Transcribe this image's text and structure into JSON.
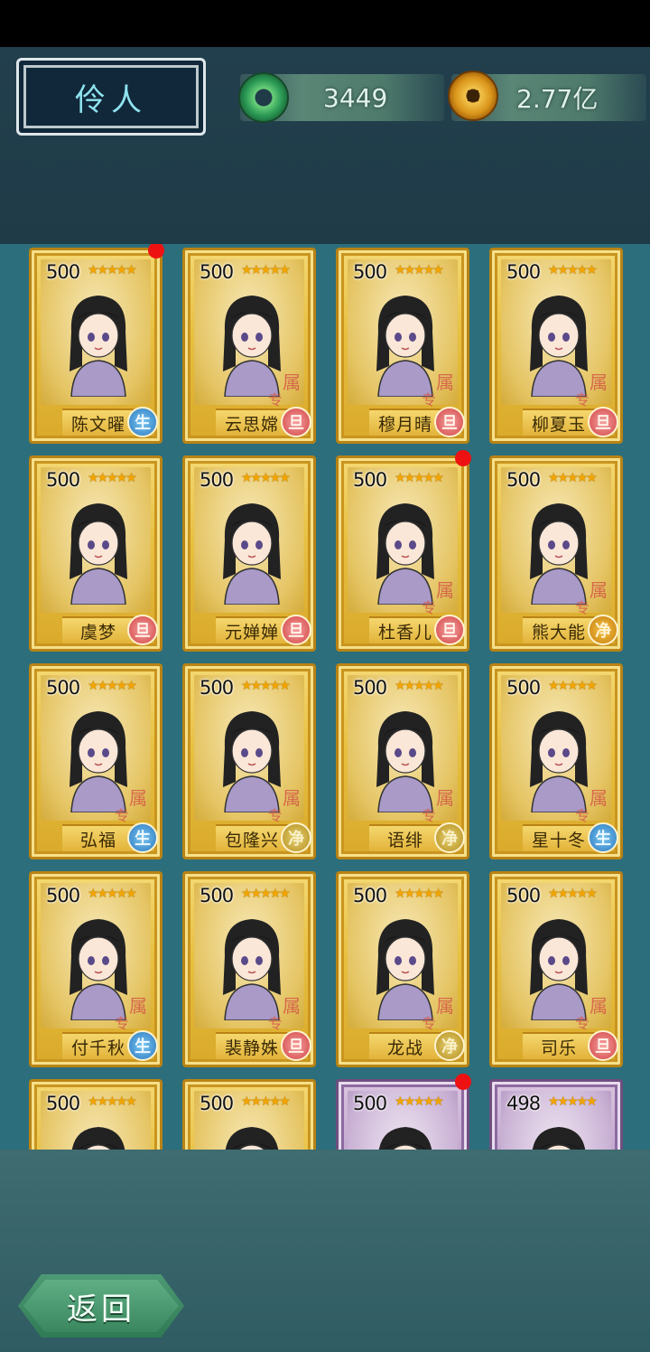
{
  "header": {
    "title": "伶人",
    "currency_jade": "3449",
    "currency_coin": "2.77亿"
  },
  "cards": [
    {
      "level": "500",
      "name": "陈文曜",
      "badge": "生",
      "badge_color": "blue",
      "dot": true,
      "frame": "gold",
      "tag": false
    },
    {
      "level": "500",
      "name": "云思嫦",
      "badge": "旦",
      "badge_color": "red",
      "dot": false,
      "frame": "gold",
      "tag": true
    },
    {
      "level": "500",
      "name": "穆月晴",
      "badge": "旦",
      "badge_color": "red",
      "dot": false,
      "frame": "gold",
      "tag": true
    },
    {
      "level": "500",
      "name": "柳夏玉",
      "badge": "旦",
      "badge_color": "red",
      "dot": false,
      "frame": "gold",
      "tag": true
    },
    {
      "level": "500",
      "name": "虞梦",
      "badge": "旦",
      "badge_color": "red",
      "dot": false,
      "frame": "gold",
      "tag": false
    },
    {
      "level": "500",
      "name": "元婵婵",
      "badge": "旦",
      "badge_color": "red",
      "dot": false,
      "frame": "gold",
      "tag": false
    },
    {
      "level": "500",
      "name": "杜香儿",
      "badge": "旦",
      "badge_color": "red",
      "dot": true,
      "frame": "gold",
      "tag": true
    },
    {
      "level": "500",
      "name": "熊大能",
      "badge": "净",
      "badge_color": "gold",
      "dot": false,
      "frame": "gold",
      "tag": true
    },
    {
      "level": "500",
      "name": "弘福",
      "badge": "生",
      "badge_color": "blue",
      "dot": false,
      "frame": "gold",
      "tag": true
    },
    {
      "level": "500",
      "name": "包隆兴",
      "badge": "净",
      "badge_color": "green",
      "dot": false,
      "frame": "gold",
      "tag": true
    },
    {
      "level": "500",
      "name": "语绯",
      "badge": "净",
      "badge_color": "green",
      "dot": false,
      "frame": "gold",
      "tag": true
    },
    {
      "level": "500",
      "name": "星十冬",
      "badge": "生",
      "badge_color": "blue",
      "dot": false,
      "frame": "gold",
      "tag": true
    },
    {
      "level": "500",
      "name": "付千秋",
      "badge": "生",
      "badge_color": "blue",
      "dot": false,
      "frame": "gold",
      "tag": true
    },
    {
      "level": "500",
      "name": "裴静姝",
      "badge": "旦",
      "badge_color": "red",
      "dot": false,
      "frame": "gold",
      "tag": true
    },
    {
      "level": "500",
      "name": "龙战",
      "badge": "净",
      "badge_color": "green",
      "dot": false,
      "frame": "gold",
      "tag": true
    },
    {
      "level": "500",
      "name": "司乐",
      "badge": "旦",
      "badge_color": "red",
      "dot": false,
      "frame": "gold",
      "tag": true
    },
    {
      "level": "500",
      "name": "",
      "badge": "",
      "badge_color": "",
      "dot": false,
      "frame": "gold",
      "tag": false
    },
    {
      "level": "500",
      "name": "",
      "badge": "",
      "badge_color": "",
      "dot": false,
      "frame": "gold",
      "tag": false
    },
    {
      "level": "500",
      "name": "",
      "badge": "",
      "badge_color": "",
      "dot": true,
      "frame": "purple",
      "tag": false
    },
    {
      "level": "498",
      "name": "",
      "badge": "",
      "badge_color": "",
      "dot": false,
      "frame": "purple",
      "tag": false
    }
  ],
  "card_tag_main": "属",
  "card_tag_sub": "专",
  "stars": "★★★★★",
  "footer": {
    "back_label": "返回"
  },
  "icons": {
    "jade": "jade-disc-icon",
    "coin": "copper-coin-icon",
    "star": "star-icon"
  },
  "colors": {
    "panel": "#2c6e7c",
    "title_text": "#8fe3ef",
    "card_gold": "#e8bf3f",
    "card_purple": "#b596c4",
    "notify_dot": "#ee1111"
  }
}
